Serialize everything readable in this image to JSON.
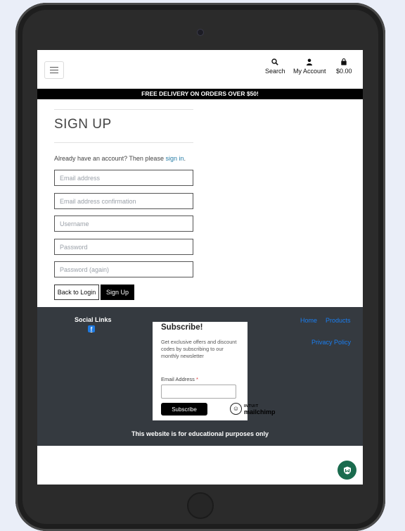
{
  "header": {
    "nav": {
      "search_label": "Search",
      "account_label": "My Account",
      "cart_total": "$0.00"
    },
    "banner": "FREE DELIVERY ON ORDERS OVER $50!"
  },
  "signup": {
    "title": "SIGN UP",
    "already_text": "Already have an account? Then please ",
    "signin_link": "sign in",
    "period": ".",
    "fields": {
      "email": "Email address",
      "email_confirm": "Email address confirmation",
      "username": "Username",
      "password": "Password",
      "password_again": "Password (again)"
    },
    "back_button": "Back to Login",
    "signup_button": "Sign Up"
  },
  "footer": {
    "social_title": "Social Links",
    "social_icon": "facebook-icon",
    "links": [
      "Home",
      "Products",
      "Privacy Policy"
    ],
    "subscribe": {
      "title": "Subscribe!",
      "description": "Get exclusive offers and discount codes by subscribing to our monthly newsletter",
      "email_label": "Email Address",
      "required_mark": "*",
      "button": "Subscribe"
    },
    "mailchimp": {
      "brand_top": "INTUIT",
      "brand_bottom": "mailchimp"
    },
    "note": "This website is for educational purposes only"
  },
  "colors": {
    "footer_bg": "#353a40",
    "link": "#1a7ef0",
    "accent_link": "#2a7fa8",
    "fab": "#1a6b4e"
  }
}
